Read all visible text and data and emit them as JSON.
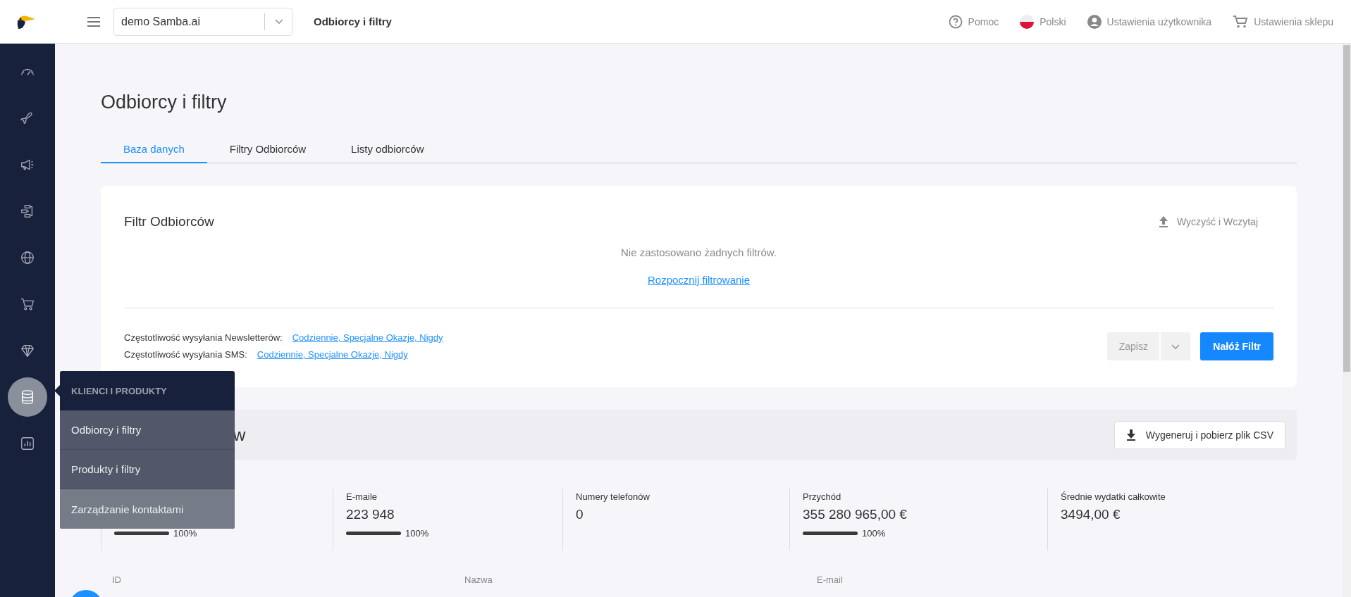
{
  "topbar": {
    "project": "demo Samba.ai",
    "page_title": "Odbiorcy i filtry",
    "links": [
      {
        "kind": "help",
        "label": "Pomoc"
      },
      {
        "kind": "flag",
        "label": "Polski"
      },
      {
        "kind": "user",
        "label": "Ustawienia użytkownika"
      },
      {
        "kind": "cart",
        "label": "Ustawienia sklepu"
      }
    ]
  },
  "sidebar": {
    "items": [
      {
        "kind": "gauge",
        "selected": false
      },
      {
        "kind": "plane",
        "selected": false
      },
      {
        "kind": "megaphone",
        "selected": false
      },
      {
        "kind": "flow",
        "selected": false
      },
      {
        "kind": "globe",
        "selected": false
      },
      {
        "kind": "cart",
        "selected": false
      },
      {
        "kind": "diamond",
        "selected": false
      },
      {
        "kind": "database",
        "selected": true
      },
      {
        "kind": "chart",
        "selected": false
      }
    ]
  },
  "popup": {
    "title": "KLIENCI I PRODUKTY",
    "items": [
      {
        "label": "Odbiorcy i filtry",
        "highlighted": false
      },
      {
        "label": "Produkty i filtry",
        "highlighted": false
      },
      {
        "label": "Zarządzanie kontaktami",
        "highlighted": true
      }
    ]
  },
  "page": {
    "title": "Odbiorcy i filtry",
    "tabs": [
      {
        "label": "Baza danych",
        "selected": true
      },
      {
        "label": "Filtry Odbiorców",
        "selected": false
      },
      {
        "label": "Listy odbiorców",
        "selected": false
      }
    ]
  },
  "filter_card": {
    "title": "Filtr Odbiorców",
    "clear_button": "Wyczyść i Wczytaj",
    "empty_text": "Nie zastosowano żadnych filtrów.",
    "start_link": "Rozpocznij filtrowanie",
    "frequencies": [
      {
        "label": "Częstotliwość wysyłania Newsletterów:",
        "value": "Codziennie, Specjalne Okazje, Nigdy"
      },
      {
        "label": "Częstotliwość wysyłania SMS:",
        "value": "Codziennie, Specjalne Okazje, Nigdy"
      }
    ],
    "save_button": {
      "label": "Zapisz",
      "disabled": true
    },
    "apply_button": "Nałóż Filtr"
  },
  "results": {
    "title": "w",
    "csv_button": "Wygeneruj i pobierz plik CSV",
    "stats": [
      {
        "percent": "100%",
        "level": 1
      },
      {
        "label": "E-maile",
        "value": "223 948",
        "percent": "100%",
        "level": 1
      },
      {
        "label": "Numery telefonów",
        "value": "0"
      },
      {
        "label": "Przychód",
        "value": "355 280 965,00 €",
        "percent": "100%",
        "level": 1
      },
      {
        "label": "Średnie wydatki całkowite",
        "value": "3494,00 €"
      }
    ],
    "columns": [
      "ID",
      "Nazwa",
      "E-mail"
    ]
  }
}
